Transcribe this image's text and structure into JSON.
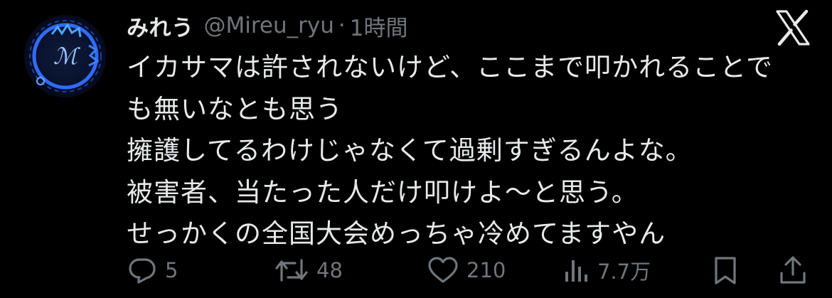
{
  "tweet": {
    "author": {
      "display_name": "みれう",
      "handle": "@Mireu_ryu",
      "separator": "·",
      "time": "1時間",
      "avatar_icon": "avatar-blue-emblem"
    },
    "platform_icon": "x-logo-icon",
    "text_lines": [
      "イカサマは許されないけど、ここまで叩かれることで",
      "も無いなとも思う",
      "擁護してるわけじゃなくて過剰すぎるんよな。",
      "被害者、当たった人だけ叩けよ〜と思う。",
      "せっかくの全国大会めっちゃ冷めてますやん"
    ],
    "actions": {
      "reply": {
        "icon": "reply-icon",
        "count": "5"
      },
      "repost": {
        "icon": "repost-icon",
        "count": "48"
      },
      "like": {
        "icon": "heart-icon",
        "count": "210"
      },
      "views": {
        "icon": "views-icon",
        "count": "7.7万"
      },
      "bookmark": {
        "icon": "bookmark-icon"
      },
      "share": {
        "icon": "share-icon"
      }
    }
  },
  "colors": {
    "background": "#000000",
    "text_primary": "#e7e9ea",
    "text_secondary": "#71767b",
    "avatar_ring": "#2a5bd7"
  }
}
